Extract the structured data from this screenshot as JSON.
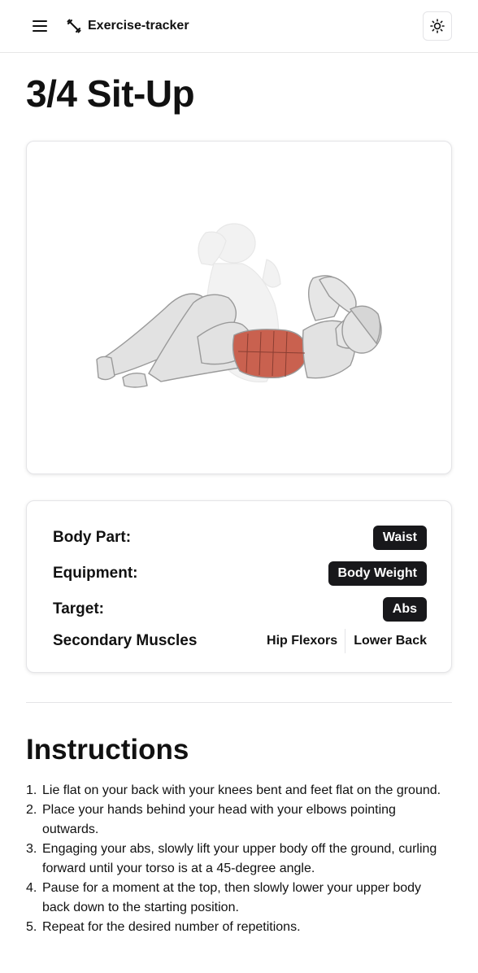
{
  "header": {
    "brand": "Exercise-tracker"
  },
  "exercise": {
    "name": "3/4 Sit-Up",
    "image_alt": "3/4 Sit-Up illustration"
  },
  "details": {
    "body_part_label": "Body Part:",
    "body_part": "Waist",
    "equipment_label": "Equipment:",
    "equipment": "Body Weight",
    "target_label": "Target:",
    "target": "Abs",
    "secondary_label": "Secondary Muscles",
    "secondary_muscles": [
      "Hip Flexors",
      "Lower Back"
    ]
  },
  "instructions": {
    "title": "Instructions",
    "steps": [
      {
        "num": "1.",
        "text": "Lie flat on your back with your knees bent and feet flat on the ground."
      },
      {
        "num": "2.",
        "text": "Place your hands behind your head with your elbows pointing outwards."
      },
      {
        "num": "3.",
        "text": "Engaging your abs, slowly lift your upper body off the ground, curling forward until your torso is at a 45-degree angle."
      },
      {
        "num": "4.",
        "text": "Pause for a moment at the top, then slowly lower your upper body back down to the starting position."
      },
      {
        "num": "5.",
        "text": "Repeat for the desired number of repetitions."
      }
    ]
  },
  "colors": {
    "accent_highlight": "#c9614f",
    "badge_bg": "#18181b"
  },
  "icons": {
    "menu": "menu-icon",
    "brand": "dumbbell-icon",
    "theme": "sun-icon"
  }
}
